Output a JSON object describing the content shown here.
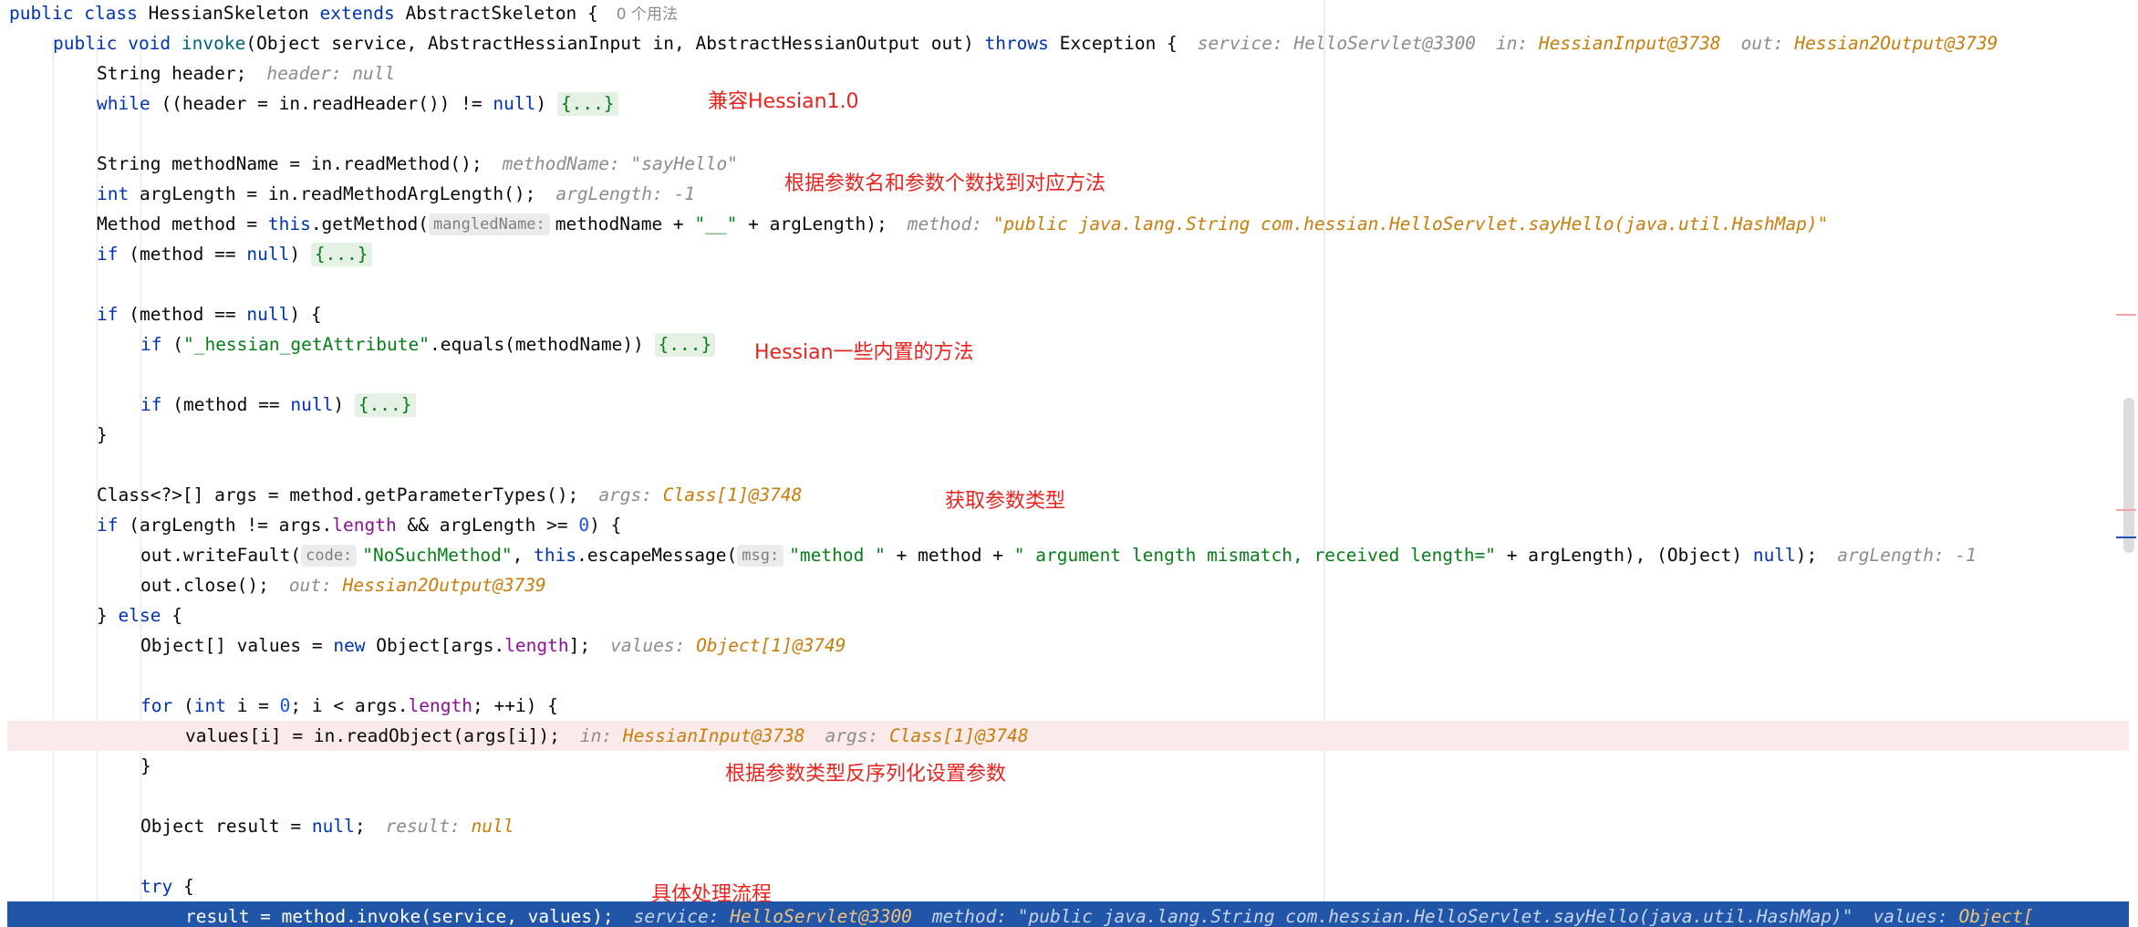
{
  "lines": {
    "class_decl": {
      "kw1": "public",
      "kw2": "class",
      "name": "HessianSkeleton",
      "kw3": "extends",
      "parent": "AbstractSkeleton",
      "brace": "{",
      "usage": "0 个用法"
    },
    "invoke_decl": {
      "kw1": "public",
      "kw2": "void",
      "fn": "invoke",
      "params": "(Object service, AbstractHessianInput in, AbstractHessianOutput out)",
      "kw3": "throws",
      "rest": "Exception {",
      "hint1_label": "service:",
      "hint1_val": "HelloServlet@3300",
      "hint2_label": "in:",
      "hint2_val": "HessianInput@3738",
      "hint3_label": "out:",
      "hint3_val": "Hessian2Output@3739"
    },
    "l_header": {
      "code": "String header;",
      "hint": "header: null"
    },
    "l_while": {
      "kw": "while",
      "mid": " ((header = in.readHeader()) != ",
      "kw2": "null",
      "end": ") ",
      "fold": "{...}"
    },
    "l_method_name": {
      "code": "String methodName = in.readMethod();",
      "hint": "methodName: \"sayHello\""
    },
    "l_arg_length": {
      "kw": "int",
      "code": " argLength = in.readMethodArgLength();",
      "hint": "argLength: -1"
    },
    "l_get_method": {
      "a": "Method method = ",
      "kw": "this",
      "b": ".getMethod(",
      "pill": "mangledName:",
      "c": "methodName + ",
      "str": "\"__\"",
      "d": " + argLength);",
      "hint_label": "method:",
      "hint_val": "\"public java.lang.String com.hessian.HelloServlet.sayHello(java.util.HashMap)\""
    },
    "l_if1": {
      "kw": "if",
      "mid": " (method == ",
      "kw2": "null",
      "end": ") ",
      "fold": "{...}"
    },
    "l_if2": {
      "kw": "if",
      "mid": " (method == ",
      "kw2": "null",
      "end": ") {"
    },
    "l_if3": {
      "kw": "if",
      "a": " (",
      "str": "\"_hessian_getAttribute\"",
      "b": ".equals(methodName)) ",
      "fold": "{...}"
    },
    "l_if4": {
      "kw": "if",
      "mid": " (method == ",
      "kw2": "null",
      "end": ") ",
      "fold": "{...}"
    },
    "l_close1": {
      "code": "}"
    },
    "l_args": {
      "code": "Class<?>[] args = method.getParameterTypes();",
      "hint_label": "args:",
      "hint_val": "Class[1]@3748"
    },
    "l_if5": {
      "kw": "if",
      "a": " (argLength != args.",
      "fld": "length",
      "b": " && argLength >= ",
      "num": "0",
      "c": ") {"
    },
    "l_write_fault": {
      "a": "out.writeFault(",
      "pill1": "code:",
      "str1": "\"NoSuchMethod\"",
      "b": ", ",
      "kw": "this",
      "c": ".escapeMessage(",
      "pill2": "msg:",
      "str2": "\"method \"",
      "d": " + method + ",
      "str3": "\" argument length mismatch, received length=\"",
      "e": " + argLength), (Object) ",
      "kw2": "null",
      "f": ");",
      "hint": "argLength: -1"
    },
    "l_out_close": {
      "code": "out.close();",
      "hint_label": "out:",
      "hint_val": "Hessian2Output@3739"
    },
    "l_else": {
      "a": "} ",
      "kw": "else",
      "b": " {"
    },
    "l_values": {
      "a": "Object[] values = ",
      "kw": "new",
      "b": " Object[args.",
      "fld": "length",
      "c": "];",
      "hint_label": "values:",
      "hint_val": "Object[1]@3749"
    },
    "l_for": {
      "kw": "for",
      "a": " (",
      "kw2": "int",
      "b": " i = ",
      "num": "0",
      "c": "; i < args.",
      "fld": "length",
      "d": "; ++i) {"
    },
    "l_read_object": {
      "code": "values[i] = in.readObject(args[i]);",
      "hint1_label": "in:",
      "hint1_val": "HessianInput@3738",
      "hint2_label": "args:",
      "hint2_val": "Class[1]@3748"
    },
    "l_close2": {
      "code": "}"
    },
    "l_result": {
      "a": "Object result = ",
      "kw": "null",
      "b": ";",
      "hint_label": "result:",
      "hint_val": "null"
    },
    "l_try": {
      "kw": "try",
      "b": " {"
    },
    "l_invoke_call": {
      "code": "result = method.invoke(service, values);",
      "hint1_label": "service:",
      "hint1_val": "HelloServlet@3300",
      "hint2_label": "method:",
      "hint2_val": "\"public java.lang.String com.hessian.HelloServlet.sayHello(java.util.HashMap)\"",
      "hint3_label": "values:",
      "hint3_val": "Object["
    }
  },
  "annotations": {
    "compat": "兼容Hessian1.0",
    "find_method": "根据参数名和参数个数找到对应方法",
    "builtin": "Hessian一些内置的方法",
    "param_types": "获取参数类型",
    "deserialize": "根据参数类型反序列化设置参数",
    "process": "具体处理流程"
  }
}
